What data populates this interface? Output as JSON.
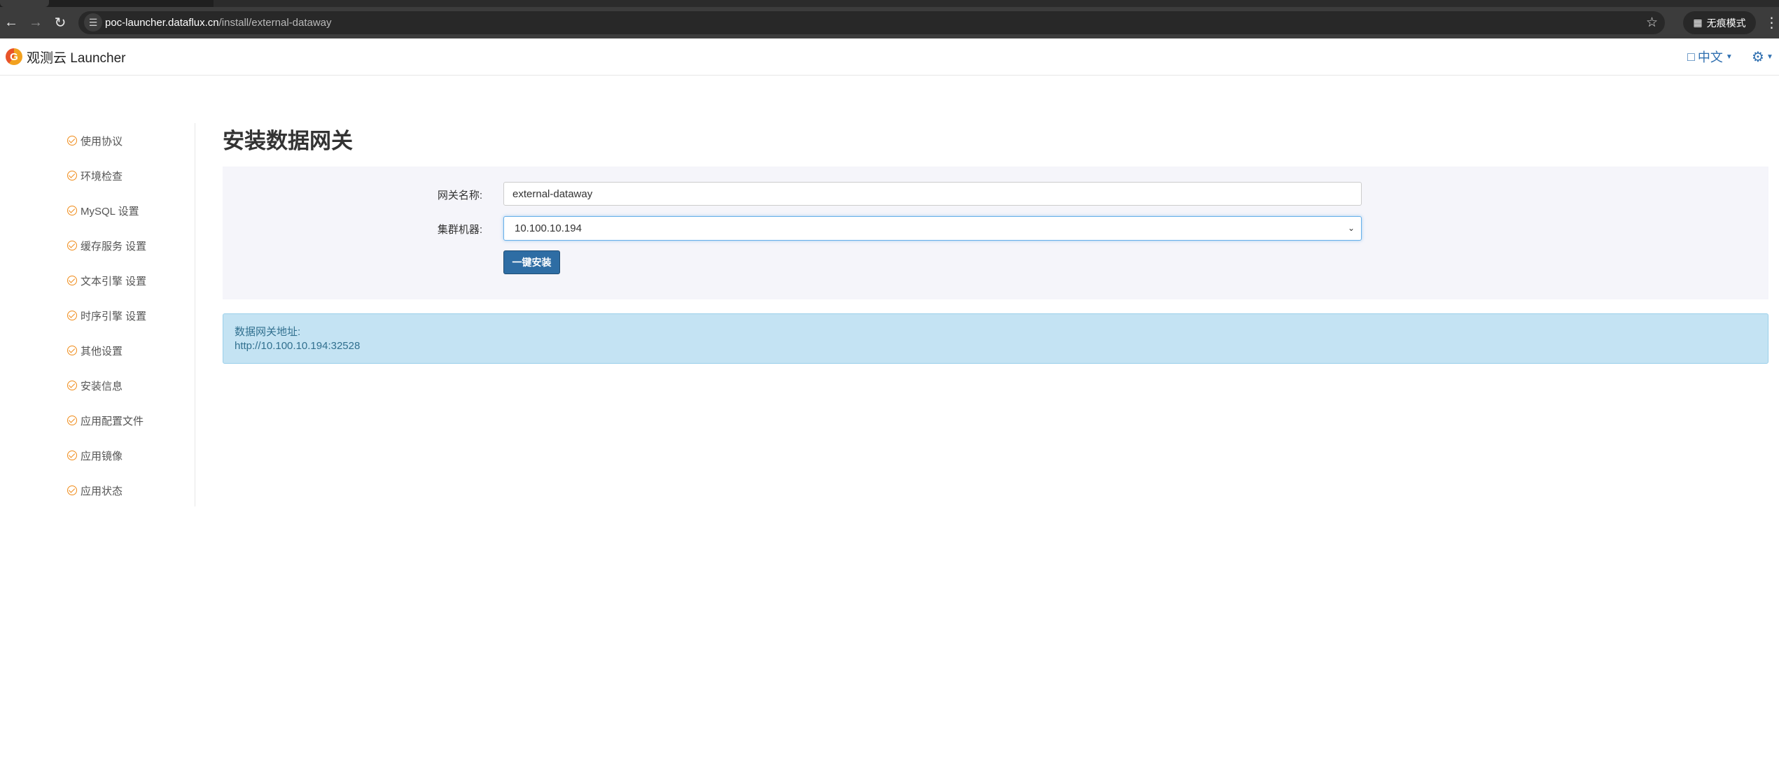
{
  "browser": {
    "url_host": "poc-launcher.dataflux.cn",
    "url_path": "/install/external-dataway",
    "incognito_label": "无痕模式",
    "icons": {
      "back": "back-arrow-icon",
      "forward": "forward-arrow-icon",
      "reload": "reload-icon",
      "star": "star-icon",
      "menu": "more-vert-icon"
    }
  },
  "header": {
    "brand_name": "观测云 Launcher",
    "language_label": "中文"
  },
  "sidebar": {
    "items": [
      {
        "label": "使用协议"
      },
      {
        "label": "环境检查"
      },
      {
        "label": "MySQL 设置"
      },
      {
        "label": "缓存服务 设置"
      },
      {
        "label": "文本引擎 设置"
      },
      {
        "label": "时序引擎 设置"
      },
      {
        "label": "其他设置"
      },
      {
        "label": "安装信息"
      },
      {
        "label": "应用配置文件"
      },
      {
        "label": "应用镜像"
      },
      {
        "label": "应用状态"
      }
    ]
  },
  "main": {
    "title": "安装数据网关",
    "form": {
      "gateway_name_label": "网关名称:",
      "gateway_name_value": "external-dataway",
      "cluster_machine_label": "集群机器:",
      "cluster_machine_value": "10.100.10.194",
      "install_button": "一键安装"
    },
    "alert": {
      "title": "数据网关地址:",
      "address": "http://10.100.10.194:32528"
    }
  },
  "colors": {
    "accent": "#2e6da4",
    "check": "#f08c1a",
    "alert_bg": "#c4e3f3",
    "alert_text": "#31708f"
  }
}
